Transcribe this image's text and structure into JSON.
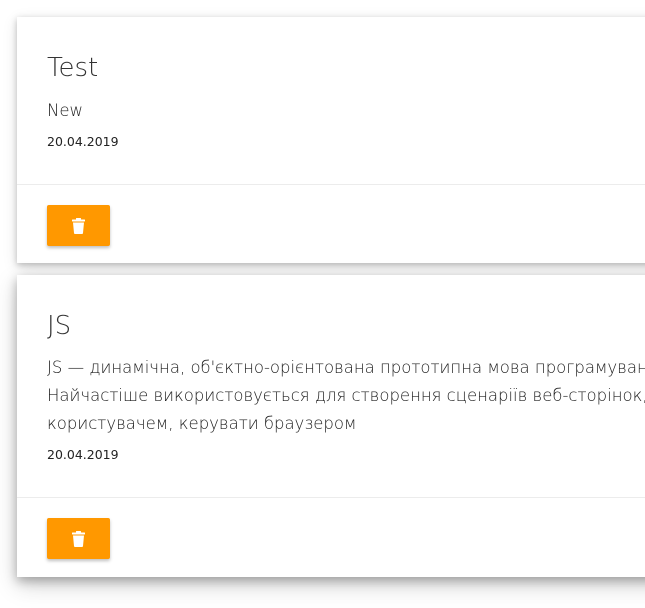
{
  "cards": [
    {
      "title": "Test",
      "text_lines": [
        "New"
      ],
      "date": "20.04.2019",
      "delete_icon": "trash-icon"
    },
    {
      "title": "JS",
      "text_lines": [
        "JS — динамічна, об'єктно-орієнтована прототипна мова програмуван",
        "Найчастіше використовується для створення сценаріїв веб-сторінок, щ",
        "користувачем, керувати браузером"
      ],
      "date": "20.04.2019",
      "delete_icon": "trash-icon"
    }
  ],
  "colors": {
    "button": "#ff9800",
    "icon": "#ffffff"
  }
}
